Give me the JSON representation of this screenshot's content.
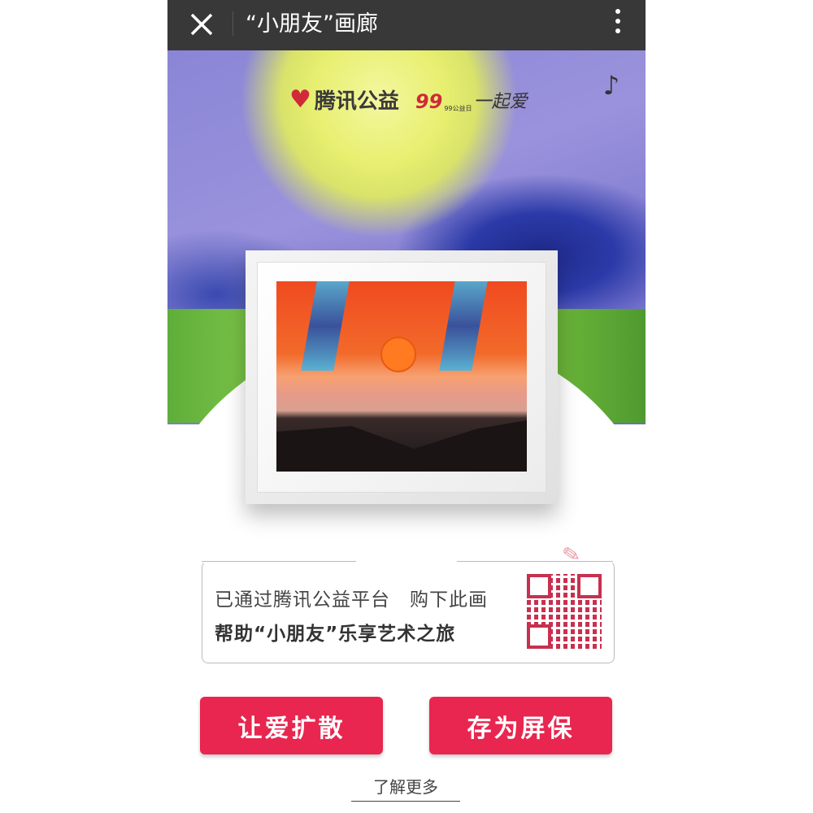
{
  "header": {
    "title": "“小朋友”画廊",
    "close_icon": "close-icon",
    "more_icon": "more-vertical-icon"
  },
  "hero": {
    "logo_tencent": "腾讯公益",
    "logo_99": "一起爱",
    "logo_99_sub": "99公益日",
    "music_icon": "music-note-icon"
  },
  "info": {
    "line1": "已通过腾讯公益平台　购下此画",
    "line2": "帮助“小朋友”乐享艺术之旅"
  },
  "buttons": {
    "share": "让爱扩散",
    "save": "存为屏保"
  },
  "learn_more": "了解更多",
  "colors": {
    "accent": "#e8264f",
    "header": "#383838"
  }
}
